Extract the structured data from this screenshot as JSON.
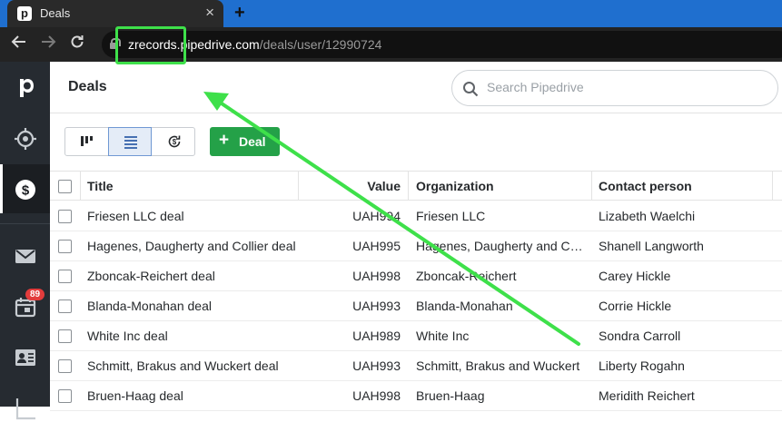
{
  "browser": {
    "tab_title": "Deals",
    "tab_close": "×",
    "new_tab": "+",
    "url_host": "zrecords.pipedrive.com",
    "url_path": "/deals/user/12990724"
  },
  "sidebar": {
    "logo_letter": "p",
    "activities_badge": "89",
    "items": [
      "logo",
      "focus",
      "deals",
      "mail",
      "activities",
      "contacts",
      "insights"
    ]
  },
  "header": {
    "title": "Deals",
    "search_placeholder": "Search Pipedrive"
  },
  "toolbar": {
    "add_icon": "+",
    "add_label": "Deal"
  },
  "table": {
    "columns": [
      "Title",
      "Value",
      "Organization",
      "Contact person"
    ],
    "rows": [
      {
        "title": "Friesen LLC deal",
        "value": "UAH994",
        "org": "Friesen LLC",
        "contact": "Lizabeth Waelchi"
      },
      {
        "title": "Hagenes, Daugherty and Collier deal",
        "value": "UAH995",
        "org": "Hagenes, Daugherty and Collier",
        "contact": "Shanell Langworth"
      },
      {
        "title": "Zboncak-Reichert deal",
        "value": "UAH998",
        "org": "Zboncak-Reichert",
        "contact": "Carey Hickle"
      },
      {
        "title": "Blanda-Monahan deal",
        "value": "UAH993",
        "org": "Blanda-Monahan",
        "contact": "Corrie Hickle"
      },
      {
        "title": "White Inc deal",
        "value": "UAH989",
        "org": "White Inc",
        "contact": "Sondra Carroll"
      },
      {
        "title": "Schmitt, Brakus and Wuckert deal",
        "value": "UAH993",
        "org": "Schmitt, Brakus and Wuckert",
        "contact": "Liberty Rogahn"
      },
      {
        "title": "Bruen-Haag deal",
        "value": "UAH998",
        "org": "Bruen-Haag",
        "contact": "Meridith Reichert"
      }
    ]
  },
  "colors": {
    "accent_green": "#24a148",
    "annotation_green": "#3ee04a",
    "sidebar_bg": "#262b31"
  }
}
